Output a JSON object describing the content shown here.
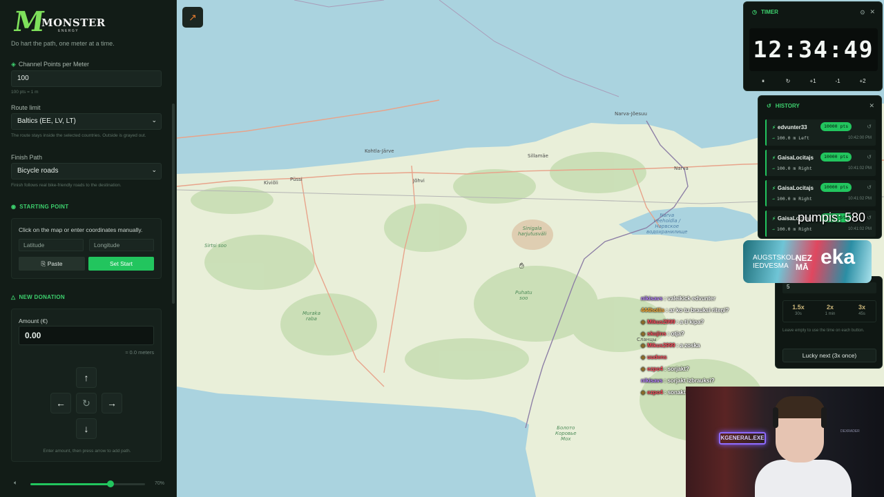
{
  "sidebar": {
    "logo": {
      "mark": "M",
      "brand": "MONSTER",
      "sub": "ENERGY"
    },
    "tagline": "Do       hart the path, one meter at a time.",
    "points_per_meter": {
      "label": "Channel Points per Meter",
      "value": "100",
      "hint": "100 pts = 1 m"
    },
    "route_limit": {
      "label": "Route limit",
      "value": "Baltics (EE, LV, LT)",
      "hint": "The route stays inside the selected countries. Outside is grayed out."
    },
    "finish_path": {
      "label": "Finish Path",
      "value": "Bicycle roads",
      "hint": "Finish follows real bike-friendly roads to the destination."
    },
    "starting_point": {
      "title": "STARTING POINT",
      "instructions": "Click on the map or enter coordinates manually.",
      "latitude_placeholder": "Latitude",
      "longitude_placeholder": "Longitude",
      "paste_label": "Paste",
      "set_start_label": "Set Start"
    },
    "new_donation": {
      "title": "NEW DONATION",
      "amount_label": "Amount (€)",
      "amount_value": "0.00",
      "meters_hint": "≈ 0.0 meters",
      "arrows_hint": "Enter amount, then press arrow to add path."
    },
    "volume": {
      "percent_label": "70%",
      "level": 0.7
    }
  },
  "map": {
    "labels": {
      "kohtla": "Kohtla-Järve",
      "kivioli": "Kiviõli",
      "pussi": "Püssi",
      "johvi": "Jõhvi",
      "sillamae": "Sillamäe",
      "narva_joesuu": "Narva-Jõesuu",
      "narva": "Narva",
      "sinigala": "Sinigala\nharjutusväli",
      "narva_reservoir": "Narva\nveehoidla /\nНарвское\nводохранилище",
      "puhatu": "Puhatu\nsoo",
      "muraka": "Muraka\nraba",
      "sirtsi": "Sirtsi soo",
      "slantsy": "Сланцы",
      "bolota": "Болото\nКоровье\nМох"
    },
    "colors": {
      "land": "#e9efd9",
      "water": "#aad3df",
      "forest": "#c8deb4",
      "road": "#e8a38a",
      "border": "#8d7fa6",
      "rail": "#b4b4b4"
    }
  },
  "timer": {
    "title": "TIMER",
    "display": "12:34:49",
    "controls": {
      "pause": "⏸",
      "reset": "↻",
      "plus1": "+1",
      "minus1": "-1",
      "plus2": "+2"
    }
  },
  "history": {
    "title": "HISTORY",
    "items": [
      {
        "user": "edvunter33",
        "points": "10000 pts",
        "meta": "100.0 m Left",
        "time": "10:42:00 PM"
      },
      {
        "user": "GaisaLocitajs",
        "points": "10000 pts",
        "meta": "100.0 m Right",
        "time": "10:41:02 PM"
      },
      {
        "user": "GaisaLocitajs",
        "points": "10000 pts",
        "meta": "100.0 m Right",
        "time": "10:41:02 PM"
      },
      {
        "user": "GaisaLocitajs",
        "points": "10000 pts",
        "meta": "100.0 m Right",
        "time": "10:41:02 PM"
      }
    ]
  },
  "overlay": {
    "pumpis": "pumpis: 580",
    "sponsor": {
      "line1": "AUGSTSKOLA\nIEDVESMA",
      "line2": "NEZ\nMĀ",
      "line3": "eka"
    }
  },
  "multiplier": {
    "input_value": "5",
    "options": [
      {
        "mult": "1.5x",
        "dur": "30s"
      },
      {
        "mult": "2x",
        "dur": "1 min"
      },
      {
        "mult": "3x",
        "dur": "45s"
      }
    ],
    "hint": "Leave empty to use the time on each button.",
    "lucky_label": "Lucky next (3x once)"
  },
  "chat": [
    {
      "user": "nikisavs",
      "color": "purple",
      "msg": ": valeikick edvunter"
    },
    {
      "user": "444hollis",
      "color": "orange",
      "msg": ": ar ko tu brauksi riteņi?"
    },
    {
      "user": "Mikus2999",
      "color": "red",
      "msg": ": a ti kipa?"
    },
    {
      "user": "skujins",
      "color": "red",
      "msg": ": otja?"
    },
    {
      "user": "Mikus2999",
      "color": "red",
      "msg": ": a zoska"
    },
    {
      "user": "uudens",
      "color": "red",
      "msg": ""
    },
    {
      "user": "ezpo4",
      "color": "red",
      "msg": ": sorjakt?"
    },
    {
      "user": "nikisavs",
      "color": "purple",
      "msg": ": sorjakt izbrauksi?"
    },
    {
      "user": "ezpo4",
      "color": "red",
      "msg": ": sonakt izbrauksi?"
    }
  ],
  "webcam": {
    "neon_sign": "KGENERAL.EXE",
    "label": "DEXRADER"
  }
}
